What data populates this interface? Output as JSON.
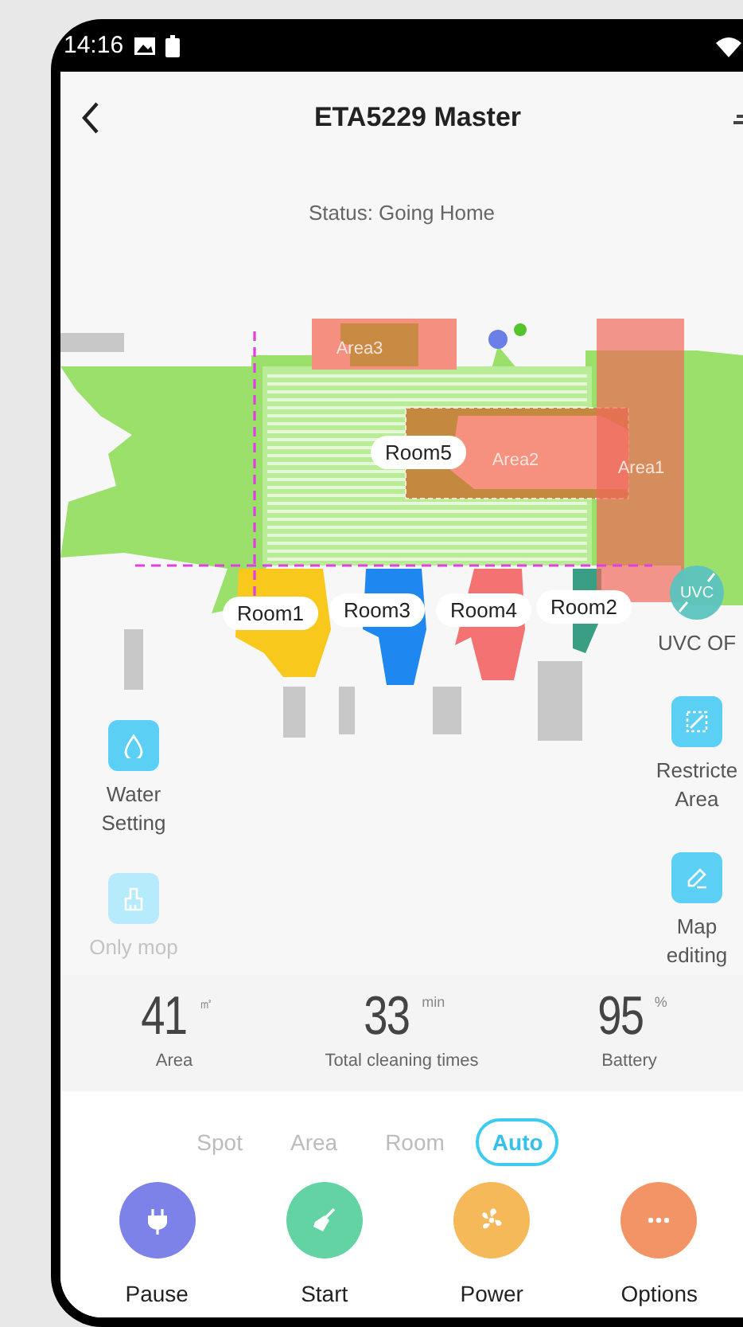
{
  "status_bar": {
    "time": "14:16"
  },
  "header": {
    "title": "ETA5229 Master"
  },
  "status": "Status: Going Home",
  "map": {
    "rooms": [
      {
        "label": "Room5",
        "color": "#b8ec96"
      },
      {
        "label": "Room1",
        "color": "#f8c81c"
      },
      {
        "label": "Room3",
        "color": "#1e88f0"
      },
      {
        "label": "Room4",
        "color": "#f47272"
      },
      {
        "label": "Room2",
        "color": "#3a9e84"
      }
    ],
    "areas": [
      {
        "label": "Area3"
      },
      {
        "label": "Area2"
      },
      {
        "label": "Area1"
      }
    ]
  },
  "left_controls": [
    {
      "kind": "water",
      "label": "Water Setting",
      "disabled": false
    },
    {
      "kind": "mop",
      "label": "Only mop",
      "disabled": true
    }
  ],
  "right_controls": [
    {
      "kind": "uvc",
      "icon_text": "UVC",
      "label": "UVC OF",
      "on": false
    },
    {
      "kind": "restrict",
      "label": "Restricte Area"
    },
    {
      "kind": "edit",
      "label": "Map editing"
    }
  ],
  "stats": [
    {
      "value": "41",
      "unit": "㎡",
      "label": "Area"
    },
    {
      "value": "33",
      "unit": "min",
      "label": "Total cleaning times"
    },
    {
      "value": "95",
      "unit": "%",
      "label": "Battery"
    }
  ],
  "modes": [
    {
      "label": "Spot",
      "selected": false
    },
    {
      "label": "Area",
      "selected": false
    },
    {
      "label": "Room",
      "selected": false
    },
    {
      "label": "Auto",
      "selected": true
    }
  ],
  "actions": [
    {
      "kind": "pause",
      "label": "Pause",
      "color": "#7d82e8"
    },
    {
      "kind": "start",
      "label": "Start",
      "color": "#63d3a4"
    },
    {
      "kind": "power",
      "label": "Power",
      "color": "#f5b95a"
    },
    {
      "kind": "options",
      "label": "Options",
      "color": "#f39466"
    }
  ]
}
